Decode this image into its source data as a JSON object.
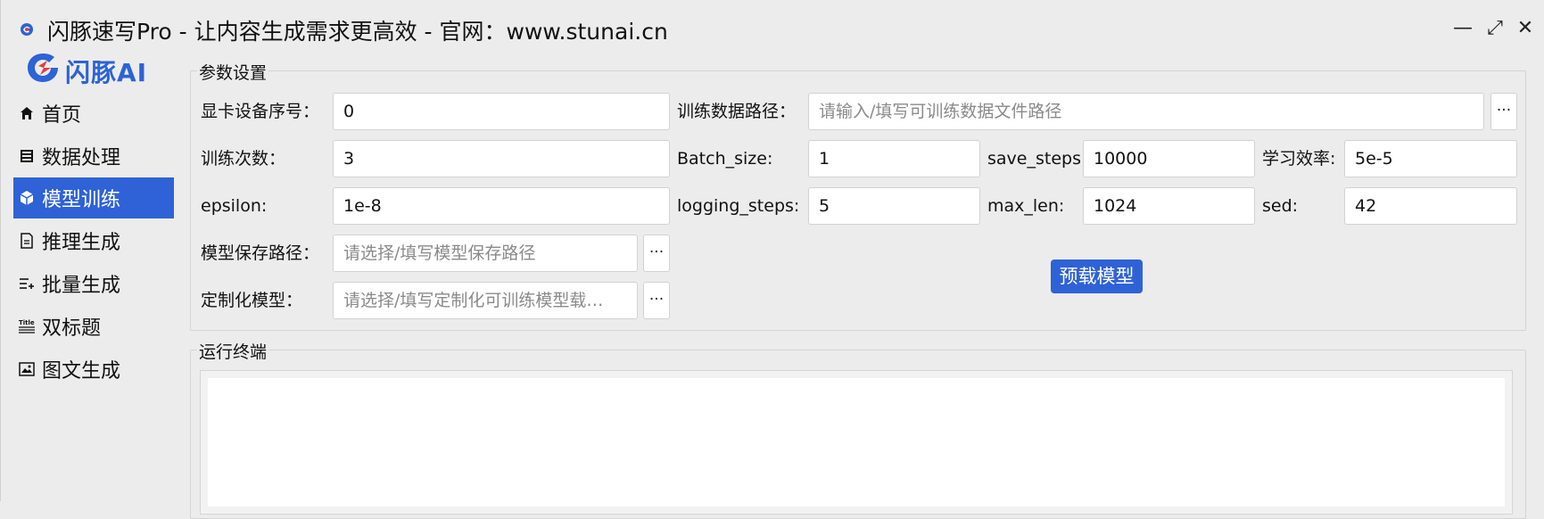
{
  "window": {
    "title": "闪豚速写Pro - 让内容生成需求更高效  -  官网：www.stunai.cn",
    "minimize_glyph": "—",
    "maximize_glyph": "⤢",
    "close_glyph": "✕"
  },
  "brand": {
    "logo_text": "闪豚AI",
    "brand_color": "#2c63d6"
  },
  "sidebar": {
    "items": [
      {
        "label": "首页",
        "icon": "home-icon"
      },
      {
        "label": "数据处理",
        "icon": "database-icon"
      },
      {
        "label": "模型训练",
        "icon": "cube-icon",
        "active": true
      },
      {
        "label": "推理生成",
        "icon": "document-icon"
      },
      {
        "label": "批量生成",
        "icon": "list-add-icon"
      },
      {
        "label": "双标题",
        "icon": "title-icon"
      },
      {
        "label": "图文生成",
        "icon": "image-icon"
      }
    ],
    "active_color": "#2f62d6"
  },
  "params": {
    "group_title": "参数设置",
    "gpu_label": "显卡设备序号：",
    "gpu_value": "0",
    "train_path_label": "训练数据路径：",
    "train_path_placeholder": "请输入/填写可训练数据文件路径",
    "epochs_label": "训练次数：",
    "epochs_value": "3",
    "batch_label": "Batch_size:",
    "batch_value": "1",
    "save_steps_label": "save_steps:",
    "save_steps_value": "10000",
    "lr_label": "学习效率:",
    "lr_value": "5e-5",
    "epsilon_label": "epsilon:",
    "epsilon_value": "1e-8",
    "logging_label": "logging_steps:",
    "logging_value": "5",
    "maxlen_label": "max_len:",
    "maxlen_value": "1024",
    "sed_label": "sed:",
    "sed_value": "42",
    "save_path_label": "模型保存路径：",
    "save_path_placeholder": "请选择/填写模型保存路径",
    "custom_label": "定制化模型：",
    "custom_placeholder": "请选择/填写定制化可训练模型载…",
    "browse_glyph": "···",
    "preload_button": "预载模型"
  },
  "terminal": {
    "group_title": "运行终端"
  }
}
